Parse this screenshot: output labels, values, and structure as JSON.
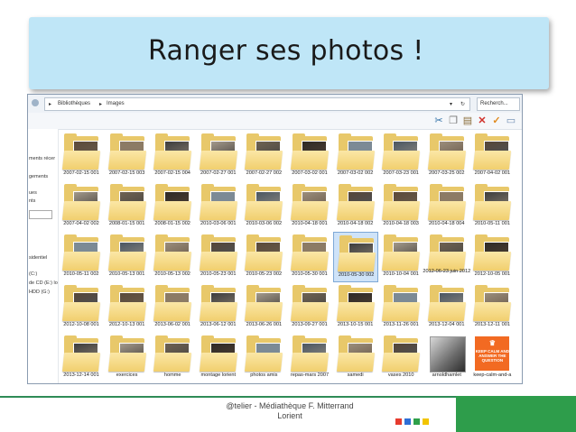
{
  "slide": {
    "title": "Ranger ses photos !"
  },
  "explorer": {
    "address": {
      "segments": [
        "Bibliothèques",
        "Images"
      ]
    },
    "search": {
      "placeholder": "Recherch..."
    },
    "toolbar": {
      "icons": [
        "scissors-icon",
        "copy-icon",
        "paste-icon",
        "delete-icon",
        "checkmark-icon",
        "folder-icon"
      ]
    },
    "sidebar": {
      "items": [
        "ments récer",
        "gements",
        "ues",
        "nts",
        "sidentiel",
        "(C:)",
        "de CD (E:) lo",
        "HDD (G:)"
      ]
    },
    "rows": [
      [
        "2007-02-15 001",
        "2007-02-15 003",
        "2007-02-15 004",
        "2007-02-27 001",
        "2007-02-27 002",
        "2007-03-02 001",
        "2007-03-02 002",
        "2007-03-23 001",
        "2007-03-25 002",
        "2007-04-02 001"
      ],
      [
        "2007-04-02 002",
        "2008-01-15 001",
        "2008-01-15 002",
        "2010-03-06 001",
        "2010-03-06 002",
        "2010-04-18 001",
        "2010-04-18 002",
        "2010-04-18 003",
        "2010-04-18 004",
        "2010-05-11 001"
      ],
      [
        "2010-05-11 002",
        "2010-05-13 001",
        "2010-05-13 002",
        "2010-05-23 001",
        "2010-05-23 002",
        "2010-05-30 001",
        "2010-05-30 002",
        "2010-10-04 001",
        "2012-06-23 juin 2012",
        "2012-10-05 001"
      ],
      [
        "2012-10-08 001",
        "2012-10-13 001",
        "2013-06-02 001",
        "2013-06-12 001",
        "2013-06-26 001",
        "2013-09-27 001",
        "2013-10-15 001",
        "2013-11-26 001",
        "2013-12-04 001",
        "2013-12-11 001"
      ],
      [
        "2013-12-14 001",
        "exercices",
        "homme",
        "montage lorient",
        "photos amis",
        "repas-mars 2007",
        "samedi",
        "vases 2010",
        "arnoldhamlet",
        "keep-calm-and-a"
      ]
    ],
    "selected": "2010-05-30 002",
    "tile_text": {
      "keep_calm": "KEEP CALM AND ANSWER THE QUESTION"
    }
  },
  "footer": {
    "line1": "@telier - Médiathèque F. Mitterrand",
    "line2": "Lorient",
    "square_colors": [
      "#e63b2e",
      "#2f6fd6",
      "#2ea04a",
      "#f2c400"
    ]
  },
  "colors": {
    "title_bg": "#bfe6f7",
    "green": "#2e9d4b",
    "folder": "#f1cf6e"
  }
}
